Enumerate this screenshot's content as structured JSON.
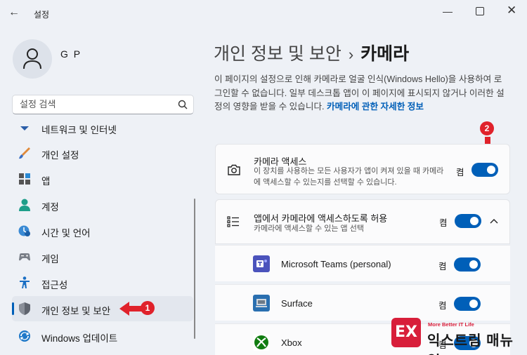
{
  "window": {
    "app_title": "설정",
    "back_glyph": "←",
    "min_glyph": "—",
    "close_glyph": "✕"
  },
  "user": {
    "name": "G P"
  },
  "search": {
    "placeholder": "설정 검색"
  },
  "sidebar": {
    "items": [
      {
        "label": "네트워크 및 인터넷",
        "icon": "network-icon"
      },
      {
        "label": "개인 설정",
        "icon": "brush-icon"
      },
      {
        "label": "앱",
        "icon": "apps-icon"
      },
      {
        "label": "계정",
        "icon": "accounts-icon"
      },
      {
        "label": "시간 및 언어",
        "icon": "time-language-icon"
      },
      {
        "label": "게임",
        "icon": "gaming-icon"
      },
      {
        "label": "접근성",
        "icon": "accessibility-icon"
      },
      {
        "label": "개인 정보 및 보안",
        "icon": "shield-icon",
        "selected": true
      },
      {
        "label": "Windows 업데이트",
        "icon": "update-icon"
      }
    ]
  },
  "breadcrumb": {
    "parent": "개인 정보 및 보안",
    "separator": "›",
    "current": "카메라"
  },
  "description": {
    "text": "이 페이지의 설정으로 인해 카메라로 얼굴 인식(Windows Hello)을 사용하여 로그인할 수 없습니다. 일부 데스크톱 앱이 이 페이지에 표시되지 않거나 이러한 설정의 영향을 받을 수 있습니다.",
    "link": "카메라에 관한 자세한 정보"
  },
  "camera_access": {
    "title": "카메라 액세스",
    "subtitle": "이 장치를 사용하는 모든 사용자가 앱이 켜져 있을 때 카메라에 액세스할 수 있는지를 선택할 수 있습니다.",
    "state": "켬",
    "on": true
  },
  "app_access": {
    "title": "앱에서 카메라에 액세스하도록 허용",
    "subtitle": "카메라에 액세스할 수 있는 앱 선택",
    "state": "켬",
    "on": true
  },
  "apps": [
    {
      "name": "Microsoft Teams (personal)",
      "state": "켬",
      "on": true,
      "icon": "teams-icon",
      "color": "#4b53bc"
    },
    {
      "name": "Surface",
      "state": "켬",
      "on": true,
      "icon": "surface-icon",
      "color": "#2a6fb0"
    },
    {
      "name": "Xbox",
      "state": "켬",
      "on": true,
      "icon": "xbox-icon",
      "color": "#107c10"
    }
  ],
  "annotations": {
    "step1": "1",
    "step2": "2",
    "color": "#e0222b"
  },
  "watermark": {
    "logo_text": "EX",
    "tagline": "More Better IT Life",
    "name": "익스트림 매뉴얼"
  },
  "colors": {
    "accent": "#005fb8",
    "background": "#eef1f6"
  }
}
